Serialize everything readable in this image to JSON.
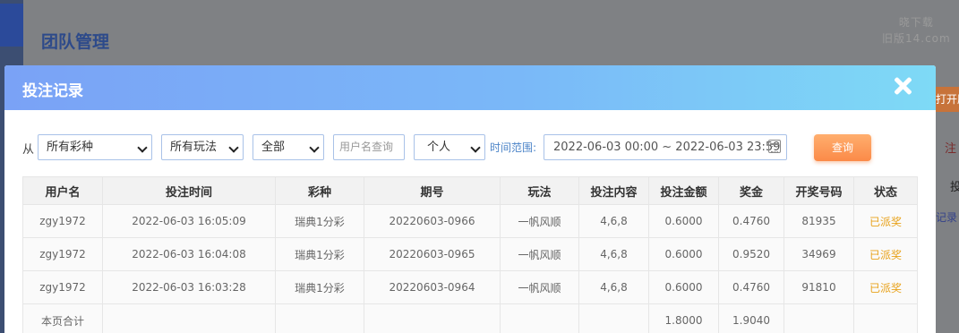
{
  "background": {
    "page_title": "团队管理",
    "watermark_line1": "晓下载",
    "watermark_line2": "旧版14.com",
    "right_edge_1": "打开历",
    "right_edge_2": "注",
    "right_edge_3": "投",
    "right_edge_4": "记录"
  },
  "modal": {
    "title": "投注记录",
    "close_icon": "close-icon"
  },
  "filters": {
    "from_label": "从",
    "lottery_select": "所有彩种",
    "play_select": "所有玩法",
    "status_select": "全部",
    "username_placeholder": "用户名查询",
    "scope_select": "个人",
    "range_label": "时间范围:",
    "date_range": "2022-06-03 00:00 ~ 2022-06-03 23:59",
    "calendar_icon": "calendar-icon",
    "query_button": "查询"
  },
  "table": {
    "headers": [
      "用户名",
      "投注时间",
      "彩种",
      "期号",
      "玩法",
      "投注内容",
      "投注金额",
      "奖金",
      "开奖号码",
      "状态"
    ],
    "rows": [
      [
        "zgy1972",
        "2022-06-03 16:05:09",
        "瑞典1分彩",
        "20220603-0966",
        "一帆风顺",
        "4,6,8",
        "0.6000",
        "0.4760",
        "81935",
        "已派奖"
      ],
      [
        "zgy1972",
        "2022-06-03 16:04:08",
        "瑞典1分彩",
        "20220603-0965",
        "一帆风顺",
        "4,6,8",
        "0.6000",
        "0.9520",
        "34969",
        "已派奖"
      ],
      [
        "zgy1972",
        "2022-06-03 16:03:28",
        "瑞典1分彩",
        "20220603-0964",
        "一帆风顺",
        "4,6,8",
        "0.6000",
        "0.4760",
        "91810",
        "已派奖"
      ]
    ],
    "total": {
      "label": "本页合计",
      "bet_amount": "1.8000",
      "bonus": "1.9040"
    },
    "status_color": "#e8a21a"
  }
}
